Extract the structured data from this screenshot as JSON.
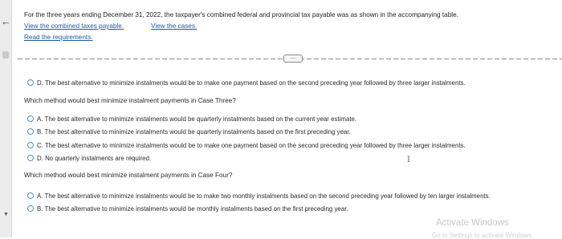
{
  "header": {
    "intro": "For the three years ending December 31, 2022, the taxpayer's combined federal and provincial tax payable was as shown in the accompanying table.",
    "link_combined": "View the combined taxes payable.",
    "link_cases": "View the cases.",
    "link_requirements": "Read the requirements."
  },
  "expand_button": "....",
  "prev_option": {
    "letter": "D.",
    "text": "The best alternative to minimize instalments would be to make one payment based on the second preceding year followed by three larger instalments."
  },
  "case3": {
    "question": "Which method would best minimize instalment payments in Case Three?",
    "options": [
      {
        "letter": "A.",
        "text": "The best alternative to minimize instalments would be quarterly instalments based on the current year estimate."
      },
      {
        "letter": "B.",
        "text": "The best alternative to minimize instalments would be quarterly instalments based on the first preceding year."
      },
      {
        "letter": "C.",
        "text": "The best alternative to minimize instalments would be to make one payment based on the second preceding year followed by three larger instalments."
      },
      {
        "letter": "D.",
        "text": "No quarterly instalments are required."
      }
    ]
  },
  "case4": {
    "question": "Which method would best minimize instalment payments in Case Four?",
    "options": [
      {
        "letter": "A.",
        "text": "The best alternative to minimize instalments would be to make two monthly instalments based on the second preceding year followed by ten larger instalments."
      },
      {
        "letter": "B.",
        "text": "The best alternative to minimize instalments would be monthly instalments based on the first preceding year."
      }
    ]
  },
  "watermark": {
    "title": "Activate Windows",
    "subtitle": "Go to Settings to activate Windows."
  }
}
